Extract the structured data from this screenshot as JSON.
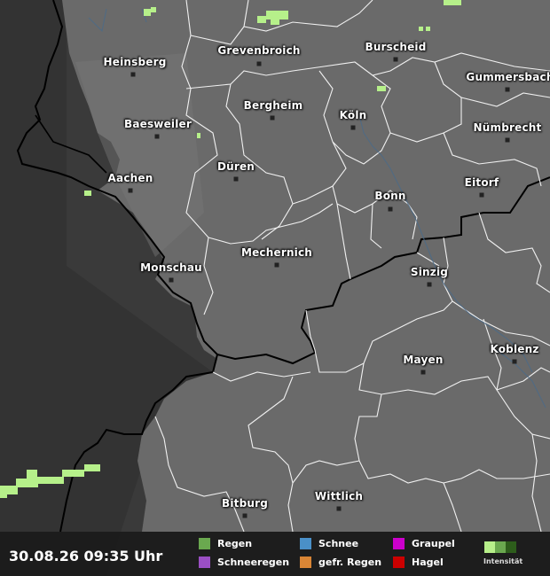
{
  "map": {
    "cities": [
      {
        "name": "Heinsberg"
      },
      {
        "name": "Grevenbroich"
      },
      {
        "name": "Burscheid"
      },
      {
        "name": "Gummersbach"
      },
      {
        "name": "Bergheim"
      },
      {
        "name": "Köln"
      },
      {
        "name": "Baesweiler"
      },
      {
        "name": "Nümbrecht"
      },
      {
        "name": "Düren"
      },
      {
        "name": "Aachen"
      },
      {
        "name": "Eitorf"
      },
      {
        "name": "Bonn"
      },
      {
        "name": "Mechernich"
      },
      {
        "name": "Monschau"
      },
      {
        "name": "Sinzig"
      },
      {
        "name": "Koblenz"
      },
      {
        "name": "Mayen"
      },
      {
        "name": "Wittlich"
      },
      {
        "name": "Bitburg"
      }
    ]
  },
  "footer": {
    "timestamp": "30.08.26 09:35 Uhr",
    "legend": [
      {
        "label": "Regen",
        "color": "#6aa84f"
      },
      {
        "label": "Schnee",
        "color": "#4a90c8"
      },
      {
        "label": "Graupel",
        "color": "#cc00cc"
      },
      {
        "label": "Schneeregen",
        "color": "#9b4fc4"
      },
      {
        "label": "gefr. Regen",
        "color": "#d98535"
      },
      {
        "label": "Hagel",
        "color": "#cc0000"
      }
    ],
    "intensity_label": "Intensität",
    "intensity_colors": [
      "#b7ef8a",
      "#6aa84f",
      "#2d5d1b"
    ]
  },
  "colors": {
    "land": "#6a6a6a",
    "outside": "#3c3c3c",
    "precip": "#b6f08a"
  }
}
